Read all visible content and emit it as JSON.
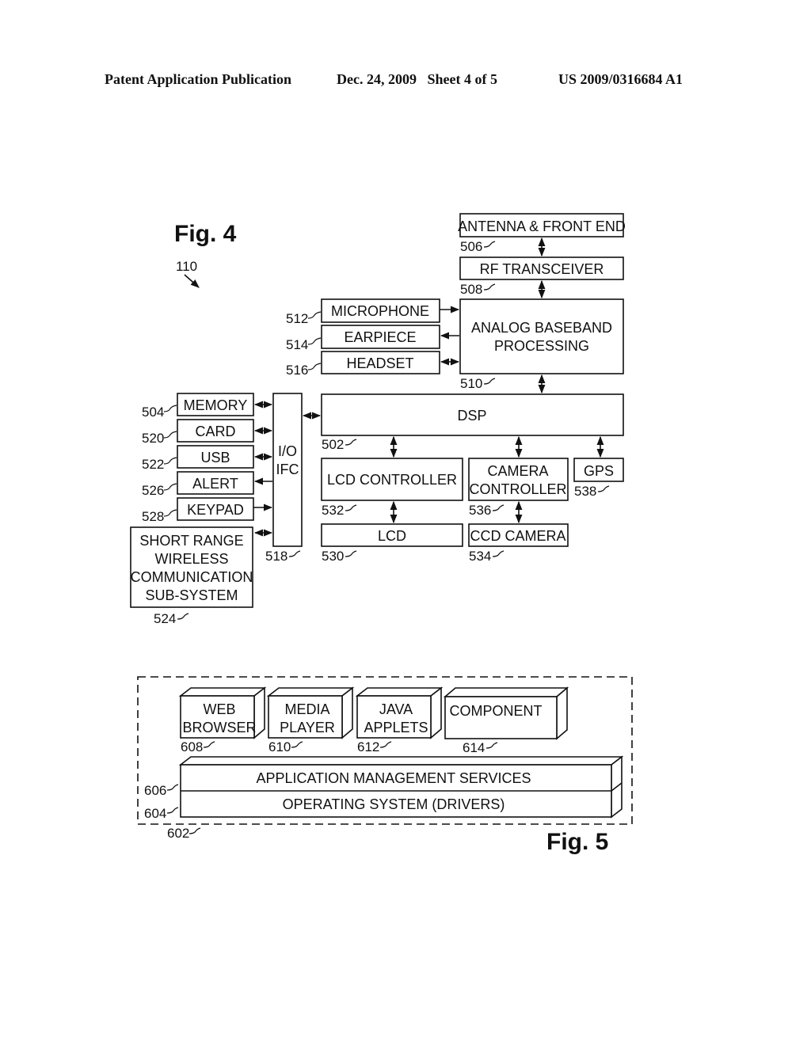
{
  "header": {
    "publication": "Patent Application Publication",
    "date_sheet": "Dec. 24, 2009   Sheet 4 of 5",
    "number": "US 2009/0316684 A1"
  },
  "fig4": {
    "title": "Fig. 4",
    "device_ref": "110",
    "blocks": {
      "antenna": {
        "label": "ANTENNA & FRONT END",
        "ref": "506"
      },
      "rf": {
        "label": "RF TRANSCEIVER",
        "ref": "508"
      },
      "analog": {
        "label1": "ANALOG BASEBAND",
        "label2": "PROCESSING",
        "ref": "510"
      },
      "microphone": {
        "label": "MICROPHONE",
        "ref": "512"
      },
      "earpiece": {
        "label": "EARPIECE",
        "ref": "514"
      },
      "headset": {
        "label": "HEADSET",
        "ref": "516"
      },
      "dsp": {
        "label": "DSP",
        "ref": "502"
      },
      "memory": {
        "label": "MEMORY",
        "ref": "504"
      },
      "card": {
        "label": "CARD",
        "ref": "520"
      },
      "usb": {
        "label": "USB",
        "ref": "522"
      },
      "alert": {
        "label": "ALERT",
        "ref": "526"
      },
      "keypad": {
        "label": "KEYPAD",
        "ref": "528"
      },
      "shortrange": {
        "label1": "SHORT RANGE",
        "label2": "WIRELESS",
        "label3": "COMMUNICATION",
        "label4": "SUB-SYSTEM",
        "ref": "524"
      },
      "io": {
        "label1": "I/O",
        "label2": "IFC",
        "ref": "518"
      },
      "lcdctrl": {
        "label": "LCD CONTROLLER",
        "ref": "532"
      },
      "camctrl": {
        "label1": "CAMERA",
        "label2": "CONTROLLER",
        "ref": "536"
      },
      "gps": {
        "label": "GPS",
        "ref": "538"
      },
      "lcd": {
        "label": "LCD",
        "ref": "530"
      },
      "ccd": {
        "label": "CCD CAMERA",
        "ref": "534"
      }
    }
  },
  "fig5": {
    "title": "Fig. 5",
    "container_ref": "602",
    "apps": [
      {
        "label1": "WEB",
        "label2": "BROWSER",
        "ref": "608"
      },
      {
        "label1": "MEDIA",
        "label2": "PLAYER",
        "ref": "610"
      },
      {
        "label1": "JAVA",
        "label2": "APPLETS",
        "ref": "612"
      },
      {
        "label1": "COMPONENT",
        "label2": "",
        "ref": "614"
      }
    ],
    "ams": {
      "label": "APPLICATION MANAGEMENT SERVICES",
      "ref": "606"
    },
    "os": {
      "label": "OPERATING SYSTEM (DRIVERS)",
      "ref": "604"
    }
  }
}
